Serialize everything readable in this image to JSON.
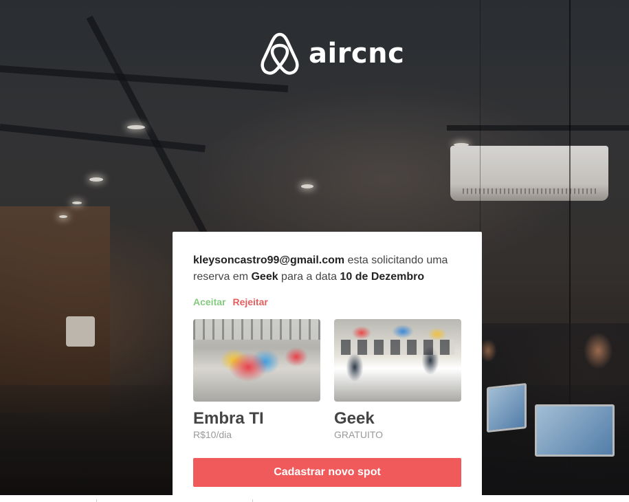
{
  "app": {
    "logo_text": "aircnc",
    "logo_icon": "airbnb-style-loop-icon"
  },
  "request": {
    "email": "kleysoncastro99@gmail.com",
    "text_1": " esta solicitando uma reserva em ",
    "spot": "Geek",
    "text_2": " para a data ",
    "date": "10 de Dezembro"
  },
  "actions": {
    "accept_label": "Aceitar",
    "reject_label": "Rejeitar"
  },
  "spots": [
    {
      "name": "Embra TI",
      "price": "R$10/dia"
    },
    {
      "name": "Geek",
      "price": "GRATUITO"
    }
  ],
  "cta": {
    "label": "Cadastrar novo spot"
  },
  "colors": {
    "brand": "#f05a5b",
    "accept": "#84cb80",
    "reject": "#e55e5e",
    "text_dark": "#444444",
    "text_muted": "#999999"
  }
}
